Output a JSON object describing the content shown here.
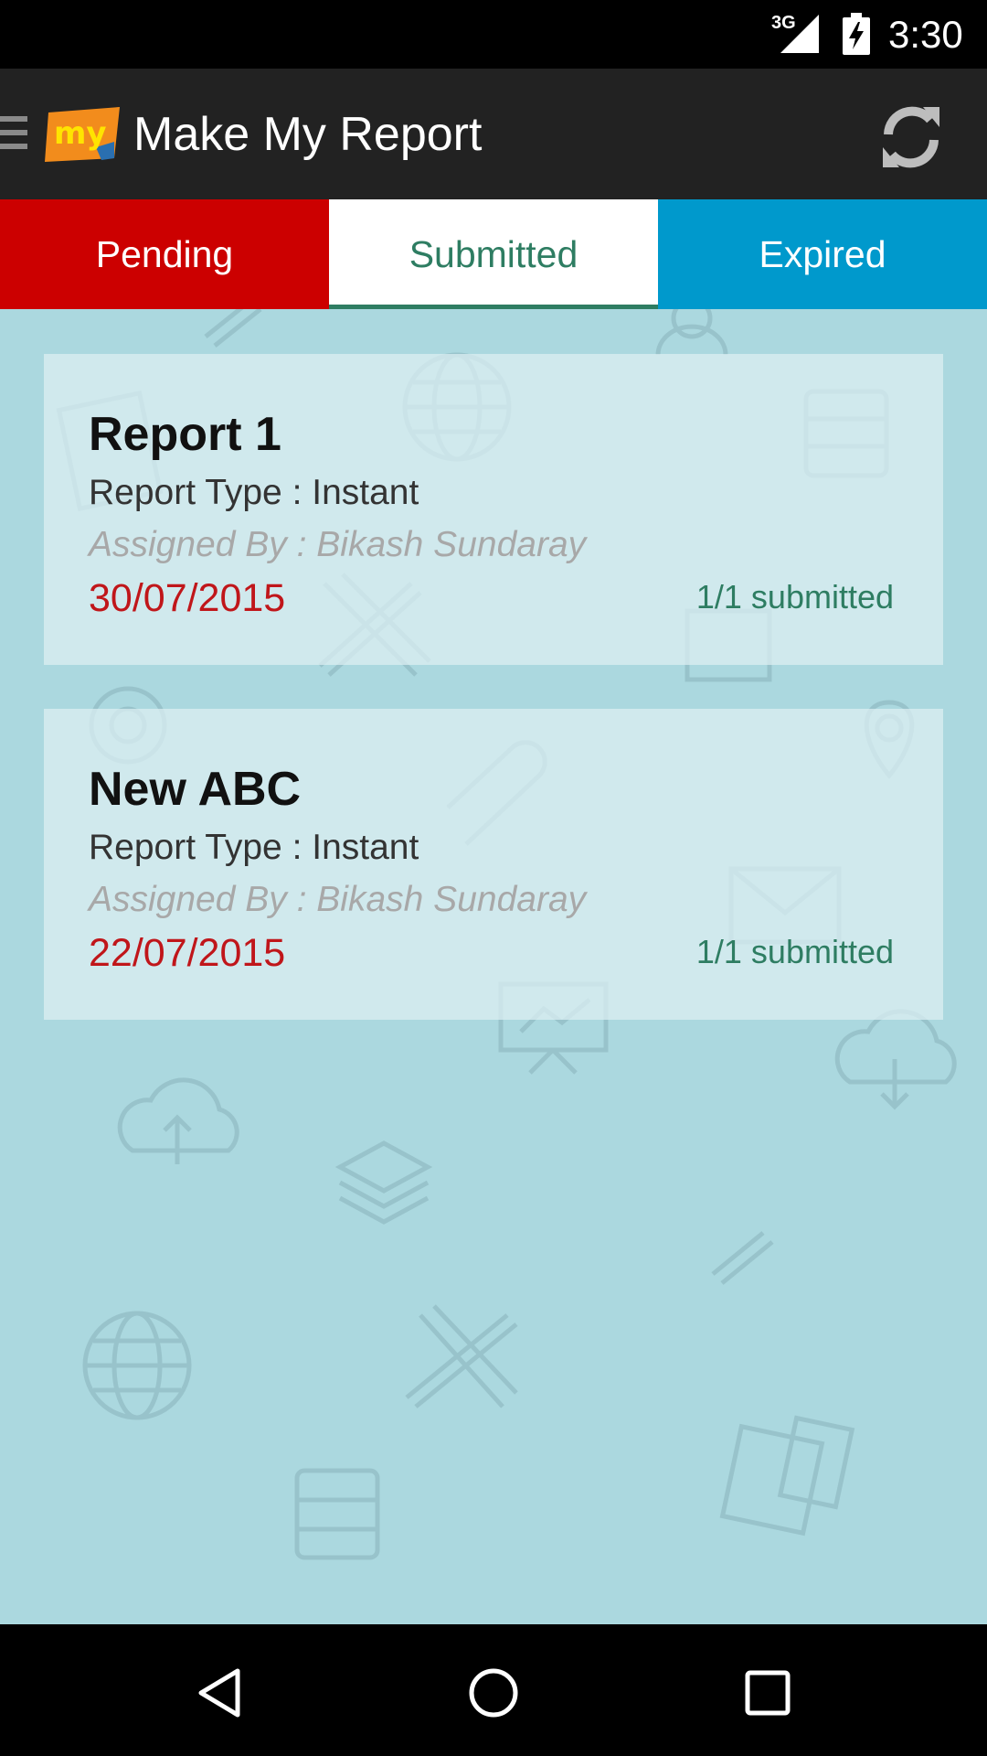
{
  "status_bar": {
    "network": "3G",
    "time": "3:30",
    "icons": [
      "signal-icon",
      "battery-charging-icon"
    ]
  },
  "app_bar": {
    "logo_text": "my",
    "title": "Make My Report",
    "icons": [
      "menu-icon",
      "refresh-icon"
    ]
  },
  "tabs": [
    {
      "label": "Pending",
      "selected": false,
      "color": "#cc0000"
    },
    {
      "label": "Submitted",
      "selected": true,
      "color": "#ffffff"
    },
    {
      "label": "Expired",
      "selected": false,
      "color": "#0099cc"
    }
  ],
  "reports": [
    {
      "title": "Report 1",
      "type": "Report Type : Instant",
      "assigned_by": "Assigned By : Bikash Sundaray",
      "date": "30/07/2015",
      "status": "1/1 submitted"
    },
    {
      "title": "New ABC",
      "type": "Report Type : Instant",
      "assigned_by": "Assigned By : Bikash Sundaray",
      "date": "22/07/2015",
      "status": "1/1 submitted"
    }
  ],
  "nav_bar": {
    "icons": [
      "back-icon",
      "home-icon",
      "recents-icon"
    ]
  },
  "colors": {
    "accent_green": "#2e7d62",
    "date_red": "#c0161a",
    "background": "#abd8df",
    "app_bar": "#222222"
  }
}
